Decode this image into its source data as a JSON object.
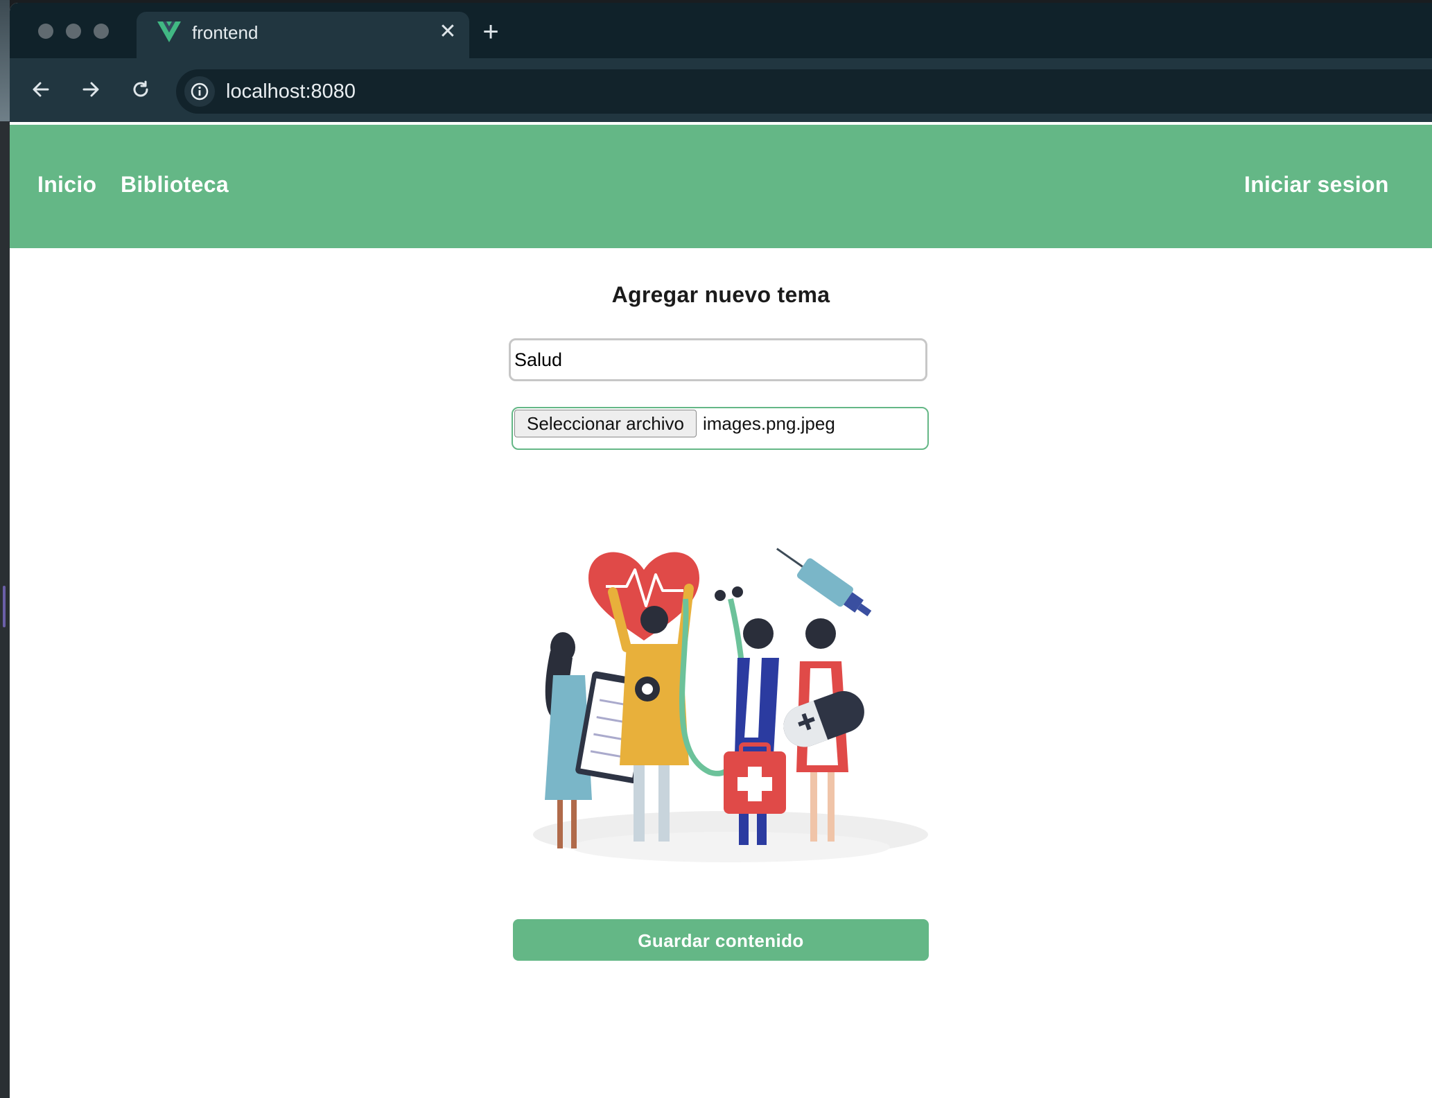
{
  "browser": {
    "tab_title": "frontend",
    "url": "localhost:8080"
  },
  "nav": {
    "home": "Inicio",
    "library": "Biblioteca",
    "login": "Iniciar sesion"
  },
  "form": {
    "heading": "Agregar nuevo tema",
    "topic_value": "Salud",
    "file_button": "Seleccionar archivo",
    "file_name": "images.png.jpeg",
    "save_label": "Guardar contenido"
  },
  "colors": {
    "brand_green": "#64b786",
    "browser_dark": "#213640",
    "vue_green": "#41b883"
  },
  "icons": {
    "back": "arrow-left-icon",
    "forward": "arrow-right-icon",
    "reload": "reload-icon",
    "site_info": "info-icon",
    "tab_close": "close-icon",
    "new_tab": "plus-icon",
    "tab_favicon": "vue-logo-icon"
  }
}
